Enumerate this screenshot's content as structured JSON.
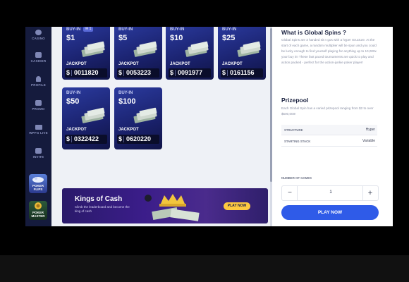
{
  "sidebar": {
    "items": [
      {
        "label": "CASINO",
        "icon": "casino-icon"
      },
      {
        "label": "CASHIER",
        "icon": "cashier-icon"
      },
      {
        "label": "PROFILE",
        "icon": "profile-icon"
      },
      {
        "label": "PROMO",
        "icon": "promo-icon"
      },
      {
        "label": "WPFG LIVE",
        "icon": "live-icon"
      },
      {
        "label": "INVITE",
        "icon": "invite-icon"
      }
    ],
    "promos": [
      {
        "label": "POKER FLIPS"
      },
      {
        "label": "POKER MASTER"
      }
    ]
  },
  "tournaments": [
    {
      "buyin_label": "BUY-IN",
      "amount": "$1",
      "badge": "✉ 1",
      "jackpot_label": "JACKPOT",
      "currency": "$",
      "jackpot": "0011820"
    },
    {
      "buyin_label": "BUY-IN",
      "amount": "$5",
      "jackpot_label": "JACKPOT",
      "currency": "$",
      "jackpot": "0053223"
    },
    {
      "buyin_label": "BUY-IN",
      "amount": "$10",
      "jackpot_label": "JACKPOT",
      "currency": "$",
      "jackpot": "0091977"
    },
    {
      "buyin_label": "BUY-IN",
      "amount": "$25",
      "jackpot_label": "JACKPOT",
      "currency": "$",
      "jackpot": "0161156"
    },
    {
      "buyin_label": "BUY-IN",
      "amount": "$50",
      "jackpot_label": "JACKPOT",
      "currency": "$",
      "jackpot": "0322422"
    },
    {
      "buyin_label": "BUY-IN",
      "amount": "$100",
      "jackpot_label": "JACKPOT",
      "currency": "$",
      "jackpot": "0620220"
    }
  ],
  "banner": {
    "title": "Kings of Cash",
    "subtitle": "Climb the leaderboard and become the king of cash",
    "button": "PLAY NOW"
  },
  "panel": {
    "heading": "What is Global Spins ?",
    "description": "Global Spins are 3 handed sit n gos with a hyper structure. At the start of each game, a random multiplier will be spun and you could be lucky enough to find yourself playing for anything up to 10,000x your buy in! These fast paced tournaments are quick to play and action packed - perfect for the action-junkie poker player!",
    "prizepool_heading": "Prizepool",
    "prizepool_text": "Each Global Spin has a varied prizepool ranging from $2 to over $500,000!",
    "rows": [
      {
        "key": "STRUCTURE",
        "value": "Hyper"
      },
      {
        "key": "STARTING STACK",
        "value": "Variable"
      }
    ],
    "games_label": "NUMBER OF GAMES",
    "games_value": "1",
    "minus": "−",
    "plus": "+",
    "play_button": "PLAY NOW"
  },
  "colors": {
    "sidebar_bg": "#151b3d",
    "card_bg": "#1b2370",
    "play_button": "#2f5be8",
    "banner_button": "#ffc940"
  }
}
